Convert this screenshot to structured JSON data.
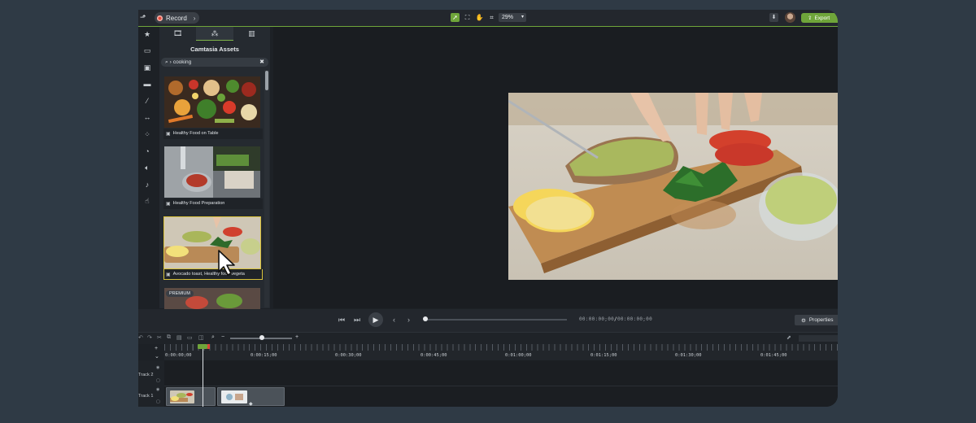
{
  "topbar": {
    "record_label": "Record",
    "zoom_value": "29%",
    "export_label": "Export"
  },
  "panel": {
    "tabs": [
      "media-tab",
      "assets-tab",
      "library-tab"
    ],
    "title": "Camtasia Assets",
    "search_value": "cooking",
    "assets": [
      {
        "caption": "Healthy Food on Table"
      },
      {
        "caption": "Healthy Food Preparation"
      },
      {
        "caption": "Avocado toast, Healthy food vegeta"
      },
      {
        "caption": "PREMIUM"
      }
    ]
  },
  "player": {
    "timecode_current": "00:00:00;00",
    "timecode_separator": "/",
    "timecode_total": "00:00:00;00",
    "properties_label": "Properties"
  },
  "timeline": {
    "ruler_labels": [
      "0:00:00;00",
      "0:00:15;00",
      "0:00:30;00",
      "0:00:45;00",
      "0:01:00;00",
      "0:01:15;00",
      "0:01:30;00",
      "0:01:45;00"
    ],
    "tracks": [
      "Track 2",
      "Track 1"
    ]
  },
  "colors": {
    "accent": "#6fa53a",
    "selection": "#d9c23a",
    "record": "#e74c3c"
  }
}
